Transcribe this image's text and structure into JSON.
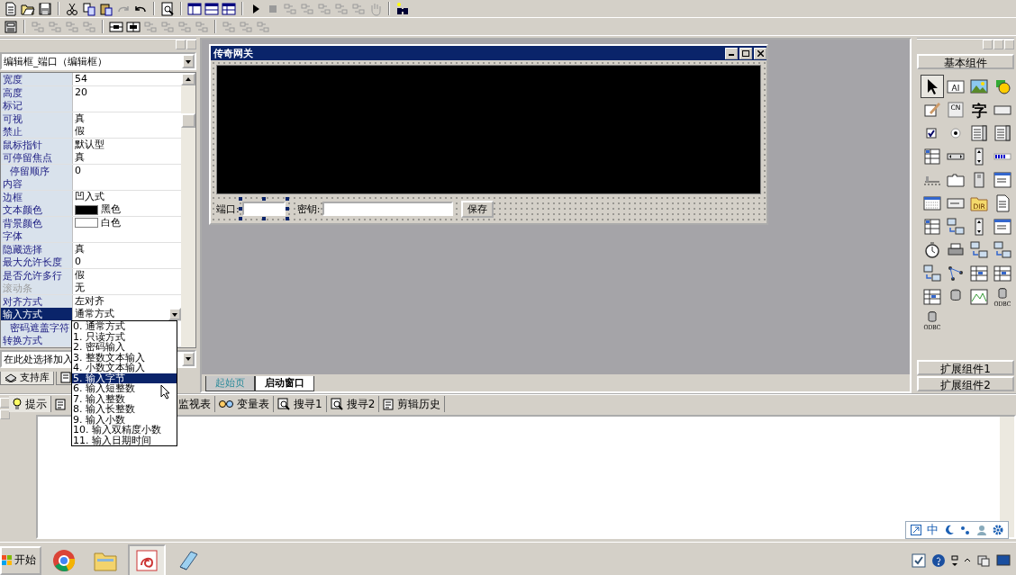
{
  "properties": {
    "object_selector": "编辑框_端口（编辑框）",
    "rows": [
      {
        "name": "宽度",
        "value": "54",
        "selected": false,
        "disabled": false
      },
      {
        "name": "高度",
        "value": "20",
        "selected": false,
        "disabled": false
      },
      {
        "name": "标记",
        "selected": false,
        "disabled": false
      },
      {
        "name": "可视",
        "value": "真",
        "selected": false,
        "disabled": false
      },
      {
        "name": "禁止",
        "value": "假",
        "selected": false,
        "disabled": false
      },
      {
        "name": "鼠标指针",
        "value": "默认型",
        "selected": false,
        "disabled": false
      },
      {
        "name": "可停留焦点",
        "value": "真",
        "selected": false,
        "disabled": false,
        "children": [
          {
            "name": "停留顺序",
            "value": "0",
            "selected": false,
            "disabled": false
          }
        ]
      },
      {
        "name": "内容",
        "selected": false,
        "disabled": false
      },
      {
        "name": "边框",
        "value": "凹入式",
        "selected": false,
        "disabled": false
      },
      {
        "name": "文本颜色",
        "value": "黑色",
        "color": "#000000",
        "selected": false,
        "disabled": false
      },
      {
        "name": "背景颜色",
        "value": "白色",
        "color": "#ffffff",
        "selected": false,
        "disabled": false
      },
      {
        "name": "字体",
        "selected": false,
        "disabled": false
      },
      {
        "name": "隐藏选择",
        "value": "真",
        "selected": false,
        "disabled": false
      },
      {
        "name": "最大允许长度",
        "value": "0",
        "selected": false,
        "disabled": false
      },
      {
        "name": "是否允许多行",
        "value": "假",
        "selected": false,
        "disabled": false
      },
      {
        "name": "滚动条",
        "value": "无",
        "selected": false,
        "disabled": true
      },
      {
        "name": "对齐方式",
        "value": "左对齐",
        "selected": false,
        "disabled": false
      },
      {
        "name": "输入方式",
        "value": "通常方式",
        "selected": true,
        "disabled": false,
        "expanded": true,
        "options": [
          {
            "label": "0. 通常方式",
            "selected": false
          },
          {
            "label": "1. 只读方式",
            "selected": false
          },
          {
            "label": "2. 密码输入",
            "selected": false
          },
          {
            "label": "3. 整数文本输入",
            "selected": false
          },
          {
            "label": "4. 小数文本输入",
            "selected": false
          },
          {
            "label": "5. 输入字节",
            "selected": true
          },
          {
            "label": "6. 输入短整数",
            "selected": false
          },
          {
            "label": "7. 输入整数",
            "selected": false
          },
          {
            "label": "8. 输入长整数",
            "selected": false
          },
          {
            "label": "9. 输入小数",
            "selected": false
          },
          {
            "label": "10. 输入双精度小数",
            "selected": false
          },
          {
            "label": "11. 输入日期时间",
            "selected": false
          }
        ],
        "children": [
          {
            "name": "密码遮盖字符",
            "selected": false,
            "disabled": false
          }
        ]
      },
      {
        "name": "转换方式",
        "selected": false,
        "disabled": false
      }
    ],
    "event_selector": "在此处选择加入"
  },
  "left_tabs": [
    {
      "kind": "library",
      "label": "支持库",
      "selected": true
    },
    {
      "kind": "program",
      "selected": false
    }
  ],
  "designer": {
    "form": {
      "title": "传奇网关",
      "port_label": "端口:",
      "port_selected": true,
      "key_label": "密钥:",
      "save_button": "保存"
    },
    "tabs": [
      {
        "label": "起始页",
        "selected": false
      },
      {
        "label": "启动窗口",
        "selected": true
      }
    ]
  },
  "component_palette": {
    "header_button": "基本组件",
    "items": [
      {
        "kind": "pointer",
        "selected": true
      },
      {
        "kind": "label",
        "text": "AI",
        "selected": false
      },
      {
        "kind": "picture",
        "selected": false
      },
      {
        "kind": "shapes",
        "selected": false
      },
      {
        "kind": "pen",
        "selected": false
      },
      {
        "kind": "frame",
        "text": "CN",
        "selected": false
      },
      {
        "kind": "glyph",
        "text": "字",
        "selected": false
      },
      {
        "kind": "button",
        "selected": false
      },
      {
        "kind": "checkbox",
        "selected": false
      },
      {
        "kind": "radio",
        "selected": false
      },
      {
        "kind": "list",
        "selected": false
      },
      {
        "kind": "list",
        "selected": false
      },
      {
        "kind": "grid",
        "selected": false
      },
      {
        "kind": "scroll",
        "selected": false
      },
      {
        "kind": "spinner",
        "selected": false
      },
      {
        "kind": "progress",
        "selected": false
      },
      {
        "kind": "slider",
        "selected": false
      },
      {
        "kind": "tab",
        "selected": false
      },
      {
        "kind": "file",
        "selected": false
      },
      {
        "kind": "window",
        "selected": false
      },
      {
        "kind": "calendar",
        "selected": false
      },
      {
        "kind": "textbox",
        "selected": false
      },
      {
        "kind": "folder",
        "text": "DIR",
        "selected": false
      },
      {
        "kind": "document",
        "selected": false
      },
      {
        "kind": "grid",
        "selected": false
      },
      {
        "kind": "computer",
        "selected": false
      },
      {
        "kind": "spinner",
        "selected": false
      },
      {
        "kind": "window",
        "selected": false
      },
      {
        "kind": "clock",
        "selected": false
      },
      {
        "kind": "printer",
        "selected": false
      },
      {
        "kind": "computer",
        "selected": false
      },
      {
        "kind": "computer",
        "selected": false
      },
      {
        "kind": "computer",
        "selected": false
      },
      {
        "kind": "tree",
        "selected": false
      },
      {
        "kind": "table",
        "selected": false
      },
      {
        "kind": "table",
        "selected": false
      },
      {
        "kind": "table",
        "selected": false
      },
      {
        "kind": "database",
        "selected": false
      },
      {
        "kind": "chart",
        "selected": false
      },
      {
        "kind": "database",
        "text": "ODBC",
        "selected": false
      },
      {
        "kind": "database",
        "text": "ODBC",
        "selected": false
      }
    ],
    "footer_buttons": [
      "扩展组件1",
      "扩展组件2"
    ]
  },
  "bottom_tabs": [
    {
      "kind": "bulb",
      "label": "提示",
      "selected": true
    },
    {
      "kind": "note",
      "selected": false
    },
    {
      "kind": "plain",
      "label": "监视表",
      "selected": false
    },
    {
      "kind": "glasses",
      "label": "变量表",
      "selected": false
    },
    {
      "kind": "search",
      "label": "搜寻1",
      "selected": false
    },
    {
      "kind": "search",
      "label": "搜寻2",
      "selected": false
    },
    {
      "kind": "note",
      "label": "剪辑历史",
      "selected": false
    }
  ],
  "taskbar": {
    "start_label": "开始",
    "apps": [
      {
        "kind": "browser",
        "selected": false
      },
      {
        "kind": "folder",
        "selected": false
      },
      {
        "kind": "editor",
        "selected": true
      },
      {
        "kind": "notepad",
        "selected": false
      }
    ],
    "ime": "中"
  }
}
